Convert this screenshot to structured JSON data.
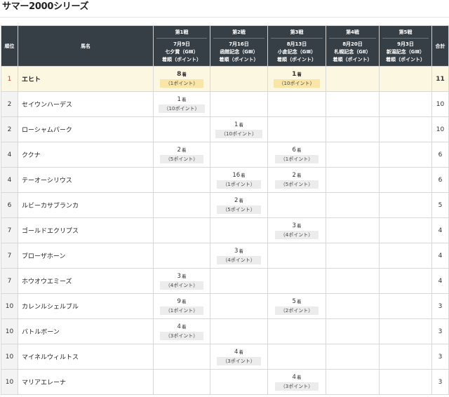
{
  "page": {
    "title": "サマー2000シリーズ"
  },
  "table": {
    "headers": {
      "rank": "順位",
      "name": "馬名",
      "total": "合計"
    },
    "races": [
      {
        "no": "第1戦",
        "date": "7月9日",
        "name": "七夕賞（GⅢ）",
        "pt": "着順（ポイント）"
      },
      {
        "no": "第2戦",
        "date": "7月16日",
        "name": "函館記念（GⅢ）",
        "pt": "着順（ポイント）"
      },
      {
        "no": "第3戦",
        "date": "8月13日",
        "name": "小倉記念（GⅢ）",
        "pt": "着順（ポイント）"
      },
      {
        "no": "第4戦",
        "date": "8月20日",
        "name": "札幌記念（GⅡ）",
        "pt": "着順（ポイント）"
      },
      {
        "no": "第5戦",
        "date": "9月3日",
        "name": "新潟記念（GⅢ）",
        "pt": "着順（ポイント）"
      }
    ],
    "rows": [
      {
        "rank": "1",
        "name": "エヒト",
        "total": "11",
        "results": [
          {
            "place": "8",
            "unit": "着",
            "pt": "（1ポイント）"
          },
          null,
          {
            "place": "1",
            "unit": "着",
            "pt": "（10ポイント）"
          },
          null,
          null
        ]
      },
      {
        "rank": "2",
        "name": "セイウンハーデス",
        "total": "10",
        "results": [
          {
            "place": "1",
            "unit": "着",
            "pt": "（10ポイント）"
          },
          null,
          null,
          null,
          null
        ]
      },
      {
        "rank": "2",
        "name": "ローシャムパーク",
        "total": "10",
        "results": [
          null,
          {
            "place": "1",
            "unit": "着",
            "pt": "（10ポイント）"
          },
          null,
          null,
          null
        ]
      },
      {
        "rank": "4",
        "name": "ククナ",
        "total": "6",
        "results": [
          {
            "place": "2",
            "unit": "着",
            "pt": "（5ポイント）"
          },
          null,
          {
            "place": "6",
            "unit": "着",
            "pt": "（1ポイント）"
          },
          null,
          null
        ]
      },
      {
        "rank": "4",
        "name": "テーオーシリウス",
        "total": "6",
        "results": [
          null,
          {
            "place": "16",
            "unit": "着",
            "pt": "（1ポイント）"
          },
          {
            "place": "2",
            "unit": "着",
            "pt": "（5ポイント）"
          },
          null,
          null
        ]
      },
      {
        "rank": "6",
        "name": "ルビーカサブランカ",
        "total": "5",
        "results": [
          null,
          {
            "place": "2",
            "unit": "着",
            "pt": "（5ポイント）"
          },
          null,
          null,
          null
        ]
      },
      {
        "rank": "7",
        "name": "ゴールドエクリプス",
        "total": "4",
        "results": [
          null,
          null,
          {
            "place": "3",
            "unit": "着",
            "pt": "（4ポイント）"
          },
          null,
          null
        ]
      },
      {
        "rank": "7",
        "name": "ブローザホーン",
        "total": "4",
        "results": [
          null,
          {
            "place": "3",
            "unit": "着",
            "pt": "（4ポイント）"
          },
          null,
          null,
          null
        ]
      },
      {
        "rank": "7",
        "name": "ホウオウエミーズ",
        "total": "4",
        "results": [
          {
            "place": "3",
            "unit": "着",
            "pt": "（4ポイント）"
          },
          null,
          null,
          null,
          null
        ]
      },
      {
        "rank": "10",
        "name": "カレンルシェルブル",
        "total": "3",
        "results": [
          {
            "place": "9",
            "unit": "着",
            "pt": "（1ポイント）"
          },
          null,
          {
            "place": "5",
            "unit": "着",
            "pt": "（2ポイント）"
          },
          null,
          null
        ]
      },
      {
        "rank": "10",
        "name": "バトルボーン",
        "total": "3",
        "results": [
          {
            "place": "4",
            "unit": "着",
            "pt": "（3ポイント）"
          },
          null,
          null,
          null,
          null
        ]
      },
      {
        "rank": "10",
        "name": "マイネルウィルトス",
        "total": "3",
        "results": [
          null,
          {
            "place": "4",
            "unit": "着",
            "pt": "（3ポイント）"
          },
          null,
          null,
          null
        ]
      },
      {
        "rank": "10",
        "name": "マリアエレーナ",
        "total": "3",
        "results": [
          null,
          null,
          {
            "place": "4",
            "unit": "着",
            "pt": "（3ポイント）"
          },
          null,
          null
        ]
      }
    ]
  }
}
